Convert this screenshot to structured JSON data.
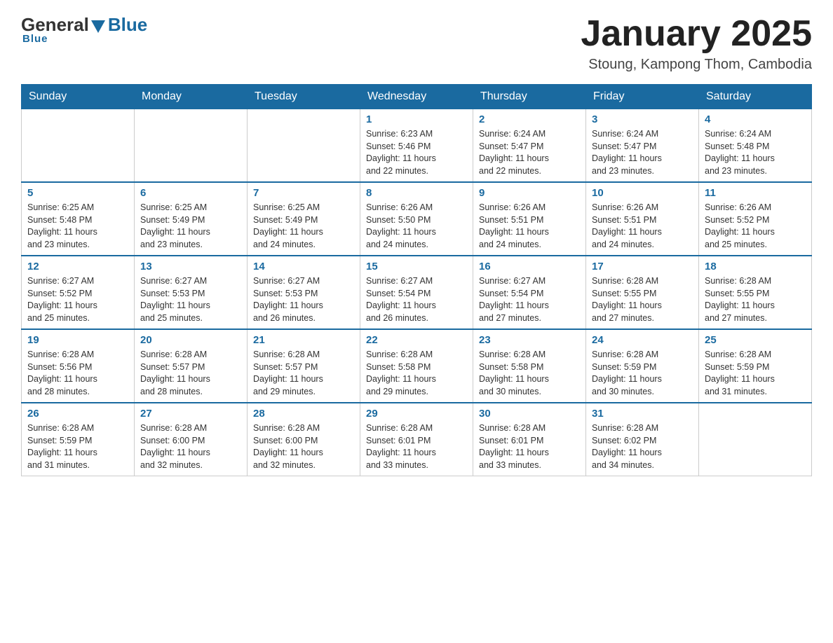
{
  "header": {
    "logo_general": "General",
    "logo_blue": "Blue",
    "logo_tagline": "Blue",
    "title": "January 2025",
    "subtitle": "Stoung, Kampong Thom, Cambodia"
  },
  "calendar": {
    "days_of_week": [
      "Sunday",
      "Monday",
      "Tuesday",
      "Wednesday",
      "Thursday",
      "Friday",
      "Saturday"
    ],
    "weeks": [
      {
        "days": [
          {
            "number": "",
            "info": ""
          },
          {
            "number": "",
            "info": ""
          },
          {
            "number": "",
            "info": ""
          },
          {
            "number": "1",
            "info": "Sunrise: 6:23 AM\nSunset: 5:46 PM\nDaylight: 11 hours\nand 22 minutes."
          },
          {
            "number": "2",
            "info": "Sunrise: 6:24 AM\nSunset: 5:47 PM\nDaylight: 11 hours\nand 22 minutes."
          },
          {
            "number": "3",
            "info": "Sunrise: 6:24 AM\nSunset: 5:47 PM\nDaylight: 11 hours\nand 23 minutes."
          },
          {
            "number": "4",
            "info": "Sunrise: 6:24 AM\nSunset: 5:48 PM\nDaylight: 11 hours\nand 23 minutes."
          }
        ]
      },
      {
        "days": [
          {
            "number": "5",
            "info": "Sunrise: 6:25 AM\nSunset: 5:48 PM\nDaylight: 11 hours\nand 23 minutes."
          },
          {
            "number": "6",
            "info": "Sunrise: 6:25 AM\nSunset: 5:49 PM\nDaylight: 11 hours\nand 23 minutes."
          },
          {
            "number": "7",
            "info": "Sunrise: 6:25 AM\nSunset: 5:49 PM\nDaylight: 11 hours\nand 24 minutes."
          },
          {
            "number": "8",
            "info": "Sunrise: 6:26 AM\nSunset: 5:50 PM\nDaylight: 11 hours\nand 24 minutes."
          },
          {
            "number": "9",
            "info": "Sunrise: 6:26 AM\nSunset: 5:51 PM\nDaylight: 11 hours\nand 24 minutes."
          },
          {
            "number": "10",
            "info": "Sunrise: 6:26 AM\nSunset: 5:51 PM\nDaylight: 11 hours\nand 24 minutes."
          },
          {
            "number": "11",
            "info": "Sunrise: 6:26 AM\nSunset: 5:52 PM\nDaylight: 11 hours\nand 25 minutes."
          }
        ]
      },
      {
        "days": [
          {
            "number": "12",
            "info": "Sunrise: 6:27 AM\nSunset: 5:52 PM\nDaylight: 11 hours\nand 25 minutes."
          },
          {
            "number": "13",
            "info": "Sunrise: 6:27 AM\nSunset: 5:53 PM\nDaylight: 11 hours\nand 25 minutes."
          },
          {
            "number": "14",
            "info": "Sunrise: 6:27 AM\nSunset: 5:53 PM\nDaylight: 11 hours\nand 26 minutes."
          },
          {
            "number": "15",
            "info": "Sunrise: 6:27 AM\nSunset: 5:54 PM\nDaylight: 11 hours\nand 26 minutes."
          },
          {
            "number": "16",
            "info": "Sunrise: 6:27 AM\nSunset: 5:54 PM\nDaylight: 11 hours\nand 27 minutes."
          },
          {
            "number": "17",
            "info": "Sunrise: 6:28 AM\nSunset: 5:55 PM\nDaylight: 11 hours\nand 27 minutes."
          },
          {
            "number": "18",
            "info": "Sunrise: 6:28 AM\nSunset: 5:55 PM\nDaylight: 11 hours\nand 27 minutes."
          }
        ]
      },
      {
        "days": [
          {
            "number": "19",
            "info": "Sunrise: 6:28 AM\nSunset: 5:56 PM\nDaylight: 11 hours\nand 28 minutes."
          },
          {
            "number": "20",
            "info": "Sunrise: 6:28 AM\nSunset: 5:57 PM\nDaylight: 11 hours\nand 28 minutes."
          },
          {
            "number": "21",
            "info": "Sunrise: 6:28 AM\nSunset: 5:57 PM\nDaylight: 11 hours\nand 29 minutes."
          },
          {
            "number": "22",
            "info": "Sunrise: 6:28 AM\nSunset: 5:58 PM\nDaylight: 11 hours\nand 29 minutes."
          },
          {
            "number": "23",
            "info": "Sunrise: 6:28 AM\nSunset: 5:58 PM\nDaylight: 11 hours\nand 30 minutes."
          },
          {
            "number": "24",
            "info": "Sunrise: 6:28 AM\nSunset: 5:59 PM\nDaylight: 11 hours\nand 30 minutes."
          },
          {
            "number": "25",
            "info": "Sunrise: 6:28 AM\nSunset: 5:59 PM\nDaylight: 11 hours\nand 31 minutes."
          }
        ]
      },
      {
        "days": [
          {
            "number": "26",
            "info": "Sunrise: 6:28 AM\nSunset: 5:59 PM\nDaylight: 11 hours\nand 31 minutes."
          },
          {
            "number": "27",
            "info": "Sunrise: 6:28 AM\nSunset: 6:00 PM\nDaylight: 11 hours\nand 32 minutes."
          },
          {
            "number": "28",
            "info": "Sunrise: 6:28 AM\nSunset: 6:00 PM\nDaylight: 11 hours\nand 32 minutes."
          },
          {
            "number": "29",
            "info": "Sunrise: 6:28 AM\nSunset: 6:01 PM\nDaylight: 11 hours\nand 33 minutes."
          },
          {
            "number": "30",
            "info": "Sunrise: 6:28 AM\nSunset: 6:01 PM\nDaylight: 11 hours\nand 33 minutes."
          },
          {
            "number": "31",
            "info": "Sunrise: 6:28 AM\nSunset: 6:02 PM\nDaylight: 11 hours\nand 34 minutes."
          },
          {
            "number": "",
            "info": ""
          }
        ]
      }
    ]
  }
}
